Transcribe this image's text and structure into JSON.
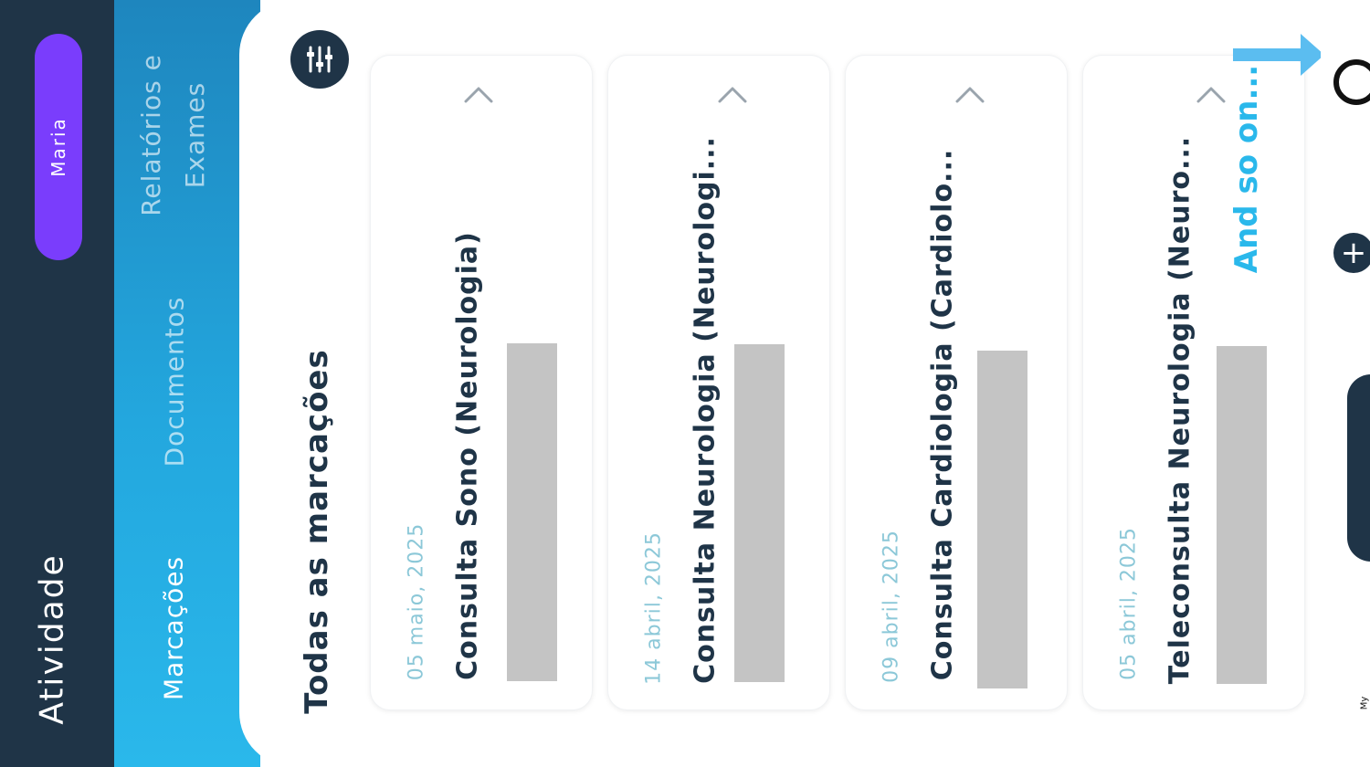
{
  "app": {
    "title": "Atividade",
    "user": "Maria"
  },
  "tabs": [
    {
      "label": "Marcações",
      "active": true
    },
    {
      "label": "Documentos",
      "active": false
    },
    {
      "label_line1": "Relatórios e",
      "label_line2": "Exames",
      "active": false
    }
  ],
  "main": {
    "section_title": "Todas as marcações",
    "filter_icon": "sliders-icon"
  },
  "cards": [
    {
      "date": "05 maio, 2025",
      "name": "Consulta Sono (Neurologia)"
    },
    {
      "date": "14 abril, 2025",
      "name": "Consulta Neurologia (Neurologi..."
    },
    {
      "date": "09 abril, 2025",
      "name": "Consulta Cardiologia (Cardiolo..."
    },
    {
      "date": "05 abril, 2025",
      "name": "Teleconsulta Neurologia (Neuro..."
    }
  ],
  "annotation": {
    "text": "And so on...",
    "color": "#2ab8eb"
  },
  "right_edge": {
    "label": "My"
  },
  "colors": {
    "dark": "#1f3447",
    "accent_purple": "#7a3dfc",
    "accent_blue": "#2ab8eb"
  }
}
